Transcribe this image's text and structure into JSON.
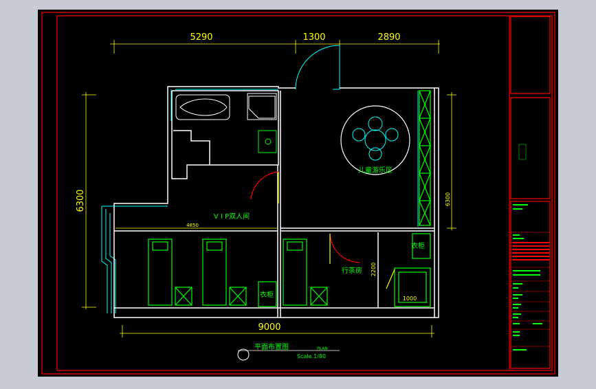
{
  "colors": {
    "background": "#000000",
    "frame": "#ff0000",
    "wall": "#ffffff",
    "furniture": "#00ff00",
    "window": "#00ffff",
    "dimension": "#ffff00",
    "door": "#ff0000"
  },
  "dimensions": {
    "top": [
      "5290",
      "1300",
      "2890"
    ],
    "bottom_total": "9000",
    "left_height": "6300",
    "right_height": "6300",
    "inner_width": "4850",
    "closet_height": "2200",
    "wardrobe_width": "1000"
  },
  "rooms": {
    "vip_room": "V I P双人间",
    "kids_play": "儿童游乐区",
    "tea_room": "行茶房"
  },
  "labels": {
    "wardrobe_left": "衣柜",
    "wardrobe_right": "衣柜"
  },
  "caption": {
    "title": "平面布置图",
    "plan": "PLAN",
    "scale": "Scale.1/80"
  }
}
